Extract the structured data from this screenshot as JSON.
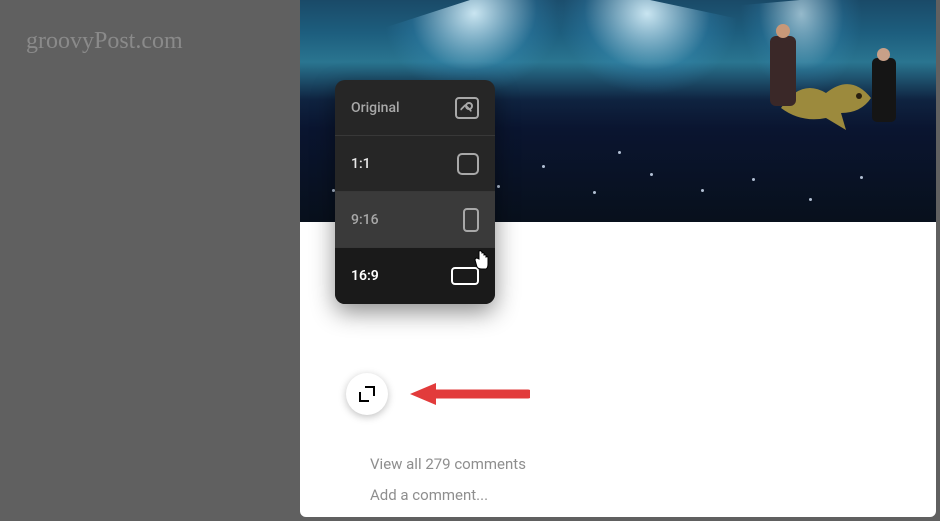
{
  "watermark": "groovyPost.com",
  "ratio_menu": {
    "options": [
      {
        "label": "Original",
        "state": ""
      },
      {
        "label": "1:1",
        "state": ""
      },
      {
        "label": "9:16",
        "state": "hover"
      },
      {
        "label": "16:9",
        "state": "selected"
      }
    ]
  },
  "comments": {
    "view_all": "View all 279 comments",
    "add_placeholder": "Add a comment..."
  }
}
